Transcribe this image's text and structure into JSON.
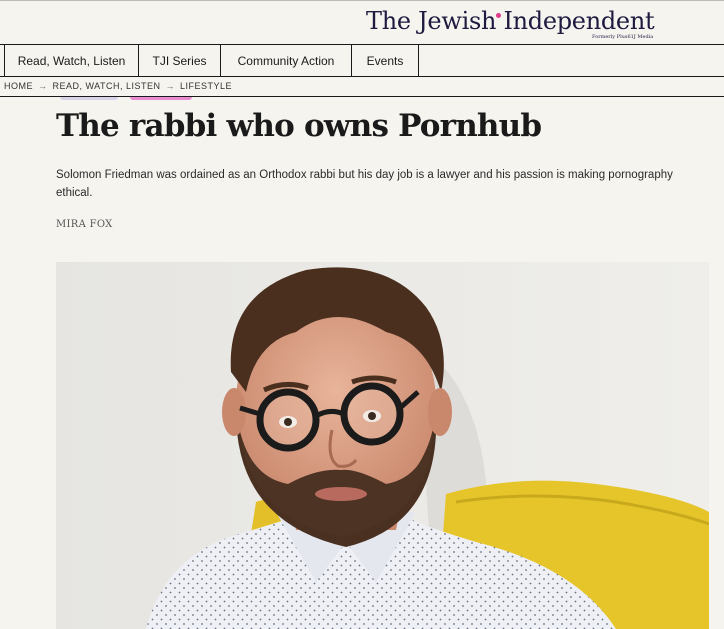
{
  "header": {
    "logo_title": "The Jewish Independent",
    "logo_subtitle": "Formerly Plus61J Media",
    "brand_color": "#1e1a40",
    "accent_color": "#e23a8c"
  },
  "nav": {
    "items": [
      {
        "label": "Read, Watch, Listen"
      },
      {
        "label": "TJI Series"
      },
      {
        "label": "Community Action"
      },
      {
        "label": "Events"
      }
    ]
  },
  "breadcrumb": {
    "items": [
      "HOME",
      "READ, WATCH, LISTEN",
      "LIFESTYLE"
    ],
    "separator_icon": "arrow-right-icon"
  },
  "article": {
    "headline": "The rabbi who owns Pornhub",
    "dek": "Solomon Friedman was ordained as an Orthodox rabbi but his day job is a lawyer and his passion is making pornography ethical.",
    "byline": "MIRA FOX"
  },
  "hero_image": {
    "subject": "portrait-photo"
  }
}
